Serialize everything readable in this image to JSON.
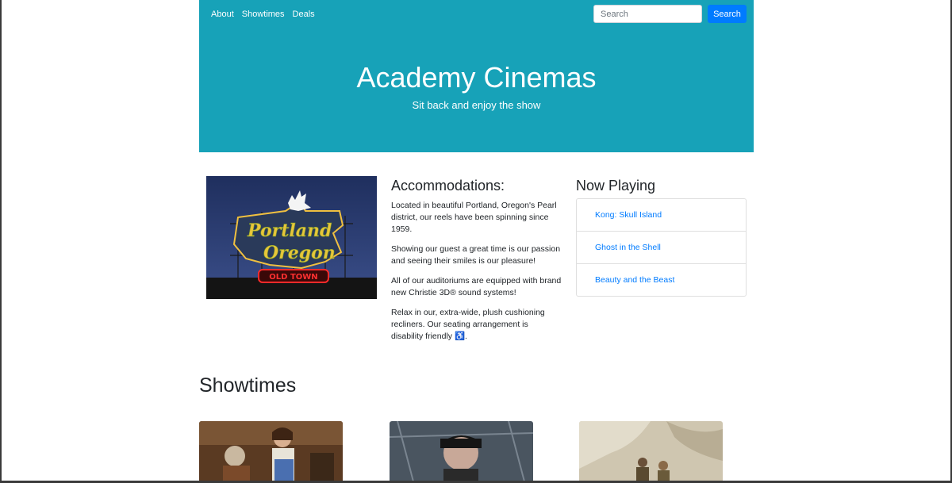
{
  "nav": {
    "links": [
      "About",
      "Showtimes",
      "Deals"
    ],
    "search_placeholder": "Search",
    "search_button": "Search"
  },
  "hero": {
    "title": "Academy Cinemas",
    "subtitle": "Sit back and enjoy the show"
  },
  "accommodations": {
    "heading": "Accommodations:",
    "paragraphs": [
      "Located in beautiful Portland, Oregon's Pearl district, our reels have been spinning since 1959.",
      "Showing our guest a great time is our passion and seeing their smiles is our pleasure!",
      "All of our auditoriums are equipped with brand new Christie 3D® sound systems!",
      "Relax in our, extra-wide, plush cushioning recliners. Our seating arrangement is disability friendly ♿."
    ]
  },
  "now_playing": {
    "heading": "Now Playing",
    "movies": [
      "Kong: Skull Island",
      "Ghost in the Shell",
      "Beauty and the Beast"
    ]
  },
  "showtimes": {
    "heading": "Showtimes"
  },
  "portland_sign": {
    "line1": "Portland",
    "line2": "Oregon",
    "line3": "OLD TOWN"
  },
  "colors": {
    "header_bg": "#17a2b8",
    "primary": "#007bff",
    "link": "#007bff"
  }
}
